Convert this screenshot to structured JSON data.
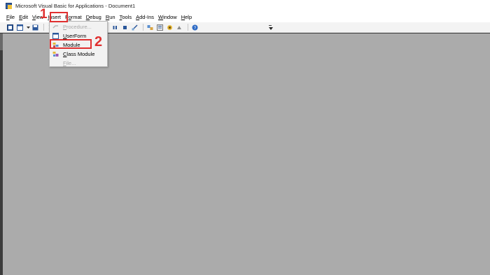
{
  "window": {
    "title": "Microsoft Visual Basic for Applications - Document1"
  },
  "menu": {
    "items": [
      {
        "pre": "",
        "u": "F",
        "post": "ile",
        "name": "file"
      },
      {
        "pre": "",
        "u": "E",
        "post": "dit",
        "name": "edit"
      },
      {
        "pre": "",
        "u": "V",
        "post": "iew",
        "name": "view"
      },
      {
        "pre": "",
        "u": "I",
        "post": "nsert",
        "name": "insert"
      },
      {
        "pre": "F",
        "u": "o",
        "post": "rmat",
        "name": "format"
      },
      {
        "pre": "",
        "u": "D",
        "post": "ebug",
        "name": "debug"
      },
      {
        "pre": "",
        "u": "R",
        "post": "un",
        "name": "run"
      },
      {
        "pre": "",
        "u": "T",
        "post": "ools",
        "name": "tools"
      },
      {
        "pre": "",
        "u": "A",
        "post": "dd-Ins",
        "name": "add-ins"
      },
      {
        "pre": "",
        "u": "W",
        "post": "indow",
        "name": "window"
      },
      {
        "pre": "",
        "u": "H",
        "post": "elp",
        "name": "help"
      }
    ]
  },
  "insert_menu": {
    "items": [
      {
        "pre": "",
        "u": "P",
        "post": "rocedure...",
        "enabled": false,
        "icon": "procedure-icon"
      },
      {
        "pre": "",
        "u": "U",
        "post": "serForm",
        "enabled": true,
        "icon": "userform-icon"
      },
      {
        "pre": "",
        "u": "M",
        "post": "odule",
        "enabled": true,
        "icon": "module-icon"
      },
      {
        "pre": "",
        "u": "C",
        "post": "lass Module",
        "enabled": true,
        "icon": "class-module-icon"
      },
      {
        "pre": "",
        "u": "F",
        "post": "ile...",
        "enabled": false,
        "icon": ""
      }
    ]
  },
  "annotations": {
    "step1": "1",
    "step2": "2",
    "color": "#e03030"
  },
  "colors": {
    "workspace": "#ababab",
    "titlebar": "#ffffff",
    "menu_bg": "#f2f2f2",
    "disabled_text": "#a8a8a8"
  }
}
